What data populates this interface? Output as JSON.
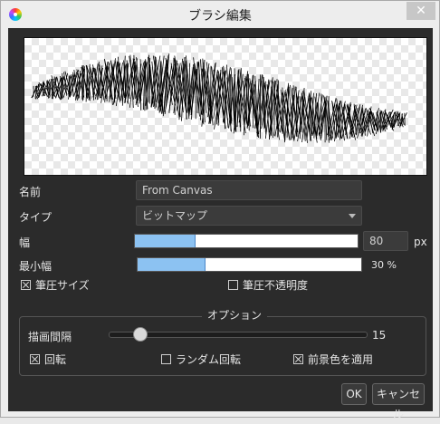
{
  "window": {
    "title": "ブラシ編集",
    "close_glyph": "✕"
  },
  "form": {
    "name_label": "名前",
    "name_value": "From Canvas",
    "type_label": "タイプ",
    "type_value": "ビットマップ",
    "width_label": "幅",
    "width_value": "80",
    "width_unit": "px",
    "width_fraction": 0.27,
    "min_width_label": "最小幅",
    "min_width_value": "30 %",
    "min_width_fraction": 0.3,
    "pressure_size_label": "筆圧サイズ",
    "pressure_size_checked": true,
    "pressure_opacity_label": "筆圧不透明度",
    "pressure_opacity_checked": false
  },
  "options": {
    "title": "オプション",
    "spacing_label": "描画間隔",
    "spacing_value": "15",
    "spacing_fraction": 0.1,
    "rotate_label": "回転",
    "rotate_checked": true,
    "random_rotate_label": "ランダム回転",
    "random_rotate_checked": false,
    "fg_color_label": "前景色を適用",
    "fg_color_checked": true
  },
  "buttons": {
    "ok": "OK",
    "cancel": "キャンセル"
  },
  "icons": {
    "app": "color-wheel-icon",
    "close": "close-icon",
    "dropdown": "chevron-down-icon"
  }
}
